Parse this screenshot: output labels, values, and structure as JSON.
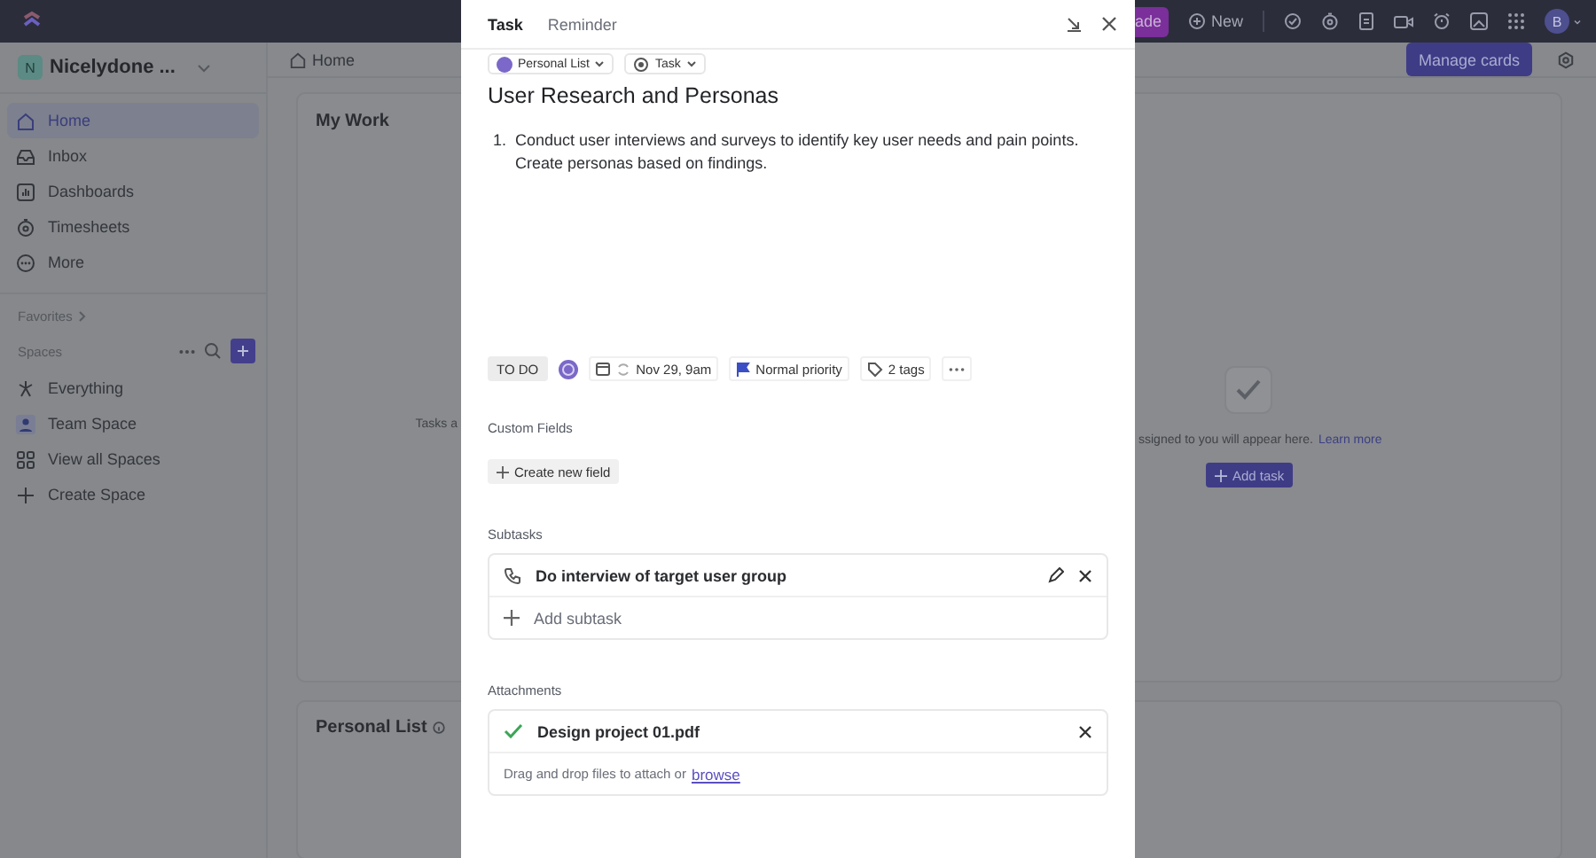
{
  "topbar": {
    "upgrade_label": "ade",
    "new_label": "New",
    "avatar": "B"
  },
  "workspace": {
    "initial": "N",
    "name": "Nicelydone ..."
  },
  "sidebar": {
    "items": [
      {
        "label": "Home",
        "kind": "home",
        "selected": true
      },
      {
        "label": "Inbox",
        "kind": "inbox",
        "selected": false
      },
      {
        "label": "Dashboards",
        "kind": "dashboards",
        "selected": false
      },
      {
        "label": "Timesheets",
        "kind": "timesheets",
        "selected": false
      },
      {
        "label": "More",
        "kind": "more",
        "selected": false
      }
    ],
    "favorites_label": "Favorites",
    "spaces_label": "Spaces",
    "spaces": [
      {
        "label": "Everything",
        "kind": "everything"
      },
      {
        "label": "Team Space",
        "kind": "team"
      },
      {
        "label": "View all Spaces",
        "kind": "all"
      },
      {
        "label": "Create Space",
        "kind": "create"
      }
    ]
  },
  "breadcrumb": "Home",
  "manage_button": "Manage cards",
  "my_work": {
    "title": "My Work",
    "empty_left": "Tasks a",
    "empty_right": "ssigned to you will appear here.",
    "link": "Learn more",
    "add_button": "Add task"
  },
  "personal_list": {
    "title": "Personal List"
  },
  "task_modal": {
    "tabs": [
      {
        "label": "Task",
        "selected": true
      },
      {
        "label": "Reminder",
        "selected": false
      }
    ],
    "list_chip": "Personal List",
    "type_chip": "Task",
    "title": "User Research and Personas",
    "description": [
      {
        "marker": "1.",
        "text": "Conduct user interviews and surveys to identify key user needs and pain points. Create personas based on findings."
      }
    ],
    "status": "TO DO",
    "due": "Nov 29, 9am",
    "priority": "Normal priority",
    "tags": "2 tags",
    "custom_fields_label": "Custom Fields",
    "create_field_button": "Create new field",
    "subtasks_label": "Subtasks",
    "subtasks": [
      {
        "title": "Do interview of target user group"
      }
    ],
    "add_subtask": "Add subtask",
    "attachments_label": "Attachments",
    "attachments": [
      {
        "name": "Design project 01.pdf"
      }
    ],
    "drop_text": "Drag and drop files to attach or",
    "browse_link": "browse"
  }
}
